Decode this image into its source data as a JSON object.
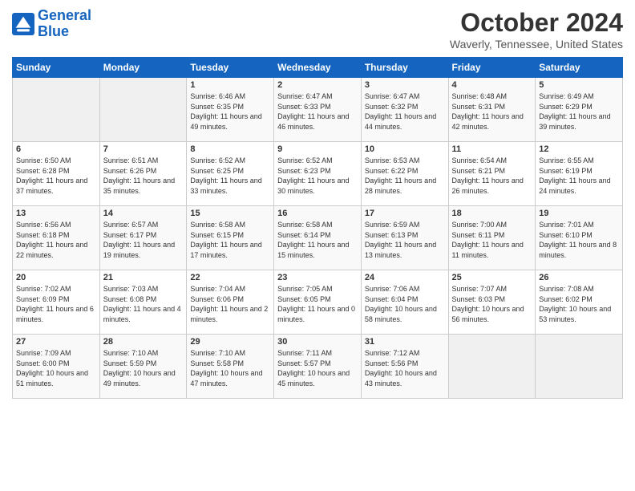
{
  "logo": {
    "line1": "General",
    "line2": "Blue"
  },
  "title": "October 2024",
  "subtitle": "Waverly, Tennessee, United States",
  "days_of_week": [
    "Sunday",
    "Monday",
    "Tuesday",
    "Wednesday",
    "Thursday",
    "Friday",
    "Saturday"
  ],
  "weeks": [
    [
      {
        "num": "",
        "info": ""
      },
      {
        "num": "",
        "info": ""
      },
      {
        "num": "1",
        "info": "Sunrise: 6:46 AM\nSunset: 6:35 PM\nDaylight: 11 hours and 49 minutes."
      },
      {
        "num": "2",
        "info": "Sunrise: 6:47 AM\nSunset: 6:33 PM\nDaylight: 11 hours and 46 minutes."
      },
      {
        "num": "3",
        "info": "Sunrise: 6:47 AM\nSunset: 6:32 PM\nDaylight: 11 hours and 44 minutes."
      },
      {
        "num": "4",
        "info": "Sunrise: 6:48 AM\nSunset: 6:31 PM\nDaylight: 11 hours and 42 minutes."
      },
      {
        "num": "5",
        "info": "Sunrise: 6:49 AM\nSunset: 6:29 PM\nDaylight: 11 hours and 39 minutes."
      }
    ],
    [
      {
        "num": "6",
        "info": "Sunrise: 6:50 AM\nSunset: 6:28 PM\nDaylight: 11 hours and 37 minutes."
      },
      {
        "num": "7",
        "info": "Sunrise: 6:51 AM\nSunset: 6:26 PM\nDaylight: 11 hours and 35 minutes."
      },
      {
        "num": "8",
        "info": "Sunrise: 6:52 AM\nSunset: 6:25 PM\nDaylight: 11 hours and 33 minutes."
      },
      {
        "num": "9",
        "info": "Sunrise: 6:52 AM\nSunset: 6:23 PM\nDaylight: 11 hours and 30 minutes."
      },
      {
        "num": "10",
        "info": "Sunrise: 6:53 AM\nSunset: 6:22 PM\nDaylight: 11 hours and 28 minutes."
      },
      {
        "num": "11",
        "info": "Sunrise: 6:54 AM\nSunset: 6:21 PM\nDaylight: 11 hours and 26 minutes."
      },
      {
        "num": "12",
        "info": "Sunrise: 6:55 AM\nSunset: 6:19 PM\nDaylight: 11 hours and 24 minutes."
      }
    ],
    [
      {
        "num": "13",
        "info": "Sunrise: 6:56 AM\nSunset: 6:18 PM\nDaylight: 11 hours and 22 minutes."
      },
      {
        "num": "14",
        "info": "Sunrise: 6:57 AM\nSunset: 6:17 PM\nDaylight: 11 hours and 19 minutes."
      },
      {
        "num": "15",
        "info": "Sunrise: 6:58 AM\nSunset: 6:15 PM\nDaylight: 11 hours and 17 minutes."
      },
      {
        "num": "16",
        "info": "Sunrise: 6:58 AM\nSunset: 6:14 PM\nDaylight: 11 hours and 15 minutes."
      },
      {
        "num": "17",
        "info": "Sunrise: 6:59 AM\nSunset: 6:13 PM\nDaylight: 11 hours and 13 minutes."
      },
      {
        "num": "18",
        "info": "Sunrise: 7:00 AM\nSunset: 6:11 PM\nDaylight: 11 hours and 11 minutes."
      },
      {
        "num": "19",
        "info": "Sunrise: 7:01 AM\nSunset: 6:10 PM\nDaylight: 11 hours and 8 minutes."
      }
    ],
    [
      {
        "num": "20",
        "info": "Sunrise: 7:02 AM\nSunset: 6:09 PM\nDaylight: 11 hours and 6 minutes."
      },
      {
        "num": "21",
        "info": "Sunrise: 7:03 AM\nSunset: 6:08 PM\nDaylight: 11 hours and 4 minutes."
      },
      {
        "num": "22",
        "info": "Sunrise: 7:04 AM\nSunset: 6:06 PM\nDaylight: 11 hours and 2 minutes."
      },
      {
        "num": "23",
        "info": "Sunrise: 7:05 AM\nSunset: 6:05 PM\nDaylight: 11 hours and 0 minutes."
      },
      {
        "num": "24",
        "info": "Sunrise: 7:06 AM\nSunset: 6:04 PM\nDaylight: 10 hours and 58 minutes."
      },
      {
        "num": "25",
        "info": "Sunrise: 7:07 AM\nSunset: 6:03 PM\nDaylight: 10 hours and 56 minutes."
      },
      {
        "num": "26",
        "info": "Sunrise: 7:08 AM\nSunset: 6:02 PM\nDaylight: 10 hours and 53 minutes."
      }
    ],
    [
      {
        "num": "27",
        "info": "Sunrise: 7:09 AM\nSunset: 6:00 PM\nDaylight: 10 hours and 51 minutes."
      },
      {
        "num": "28",
        "info": "Sunrise: 7:10 AM\nSunset: 5:59 PM\nDaylight: 10 hours and 49 minutes."
      },
      {
        "num": "29",
        "info": "Sunrise: 7:10 AM\nSunset: 5:58 PM\nDaylight: 10 hours and 47 minutes."
      },
      {
        "num": "30",
        "info": "Sunrise: 7:11 AM\nSunset: 5:57 PM\nDaylight: 10 hours and 45 minutes."
      },
      {
        "num": "31",
        "info": "Sunrise: 7:12 AM\nSunset: 5:56 PM\nDaylight: 10 hours and 43 minutes."
      },
      {
        "num": "",
        "info": ""
      },
      {
        "num": "",
        "info": ""
      }
    ]
  ]
}
